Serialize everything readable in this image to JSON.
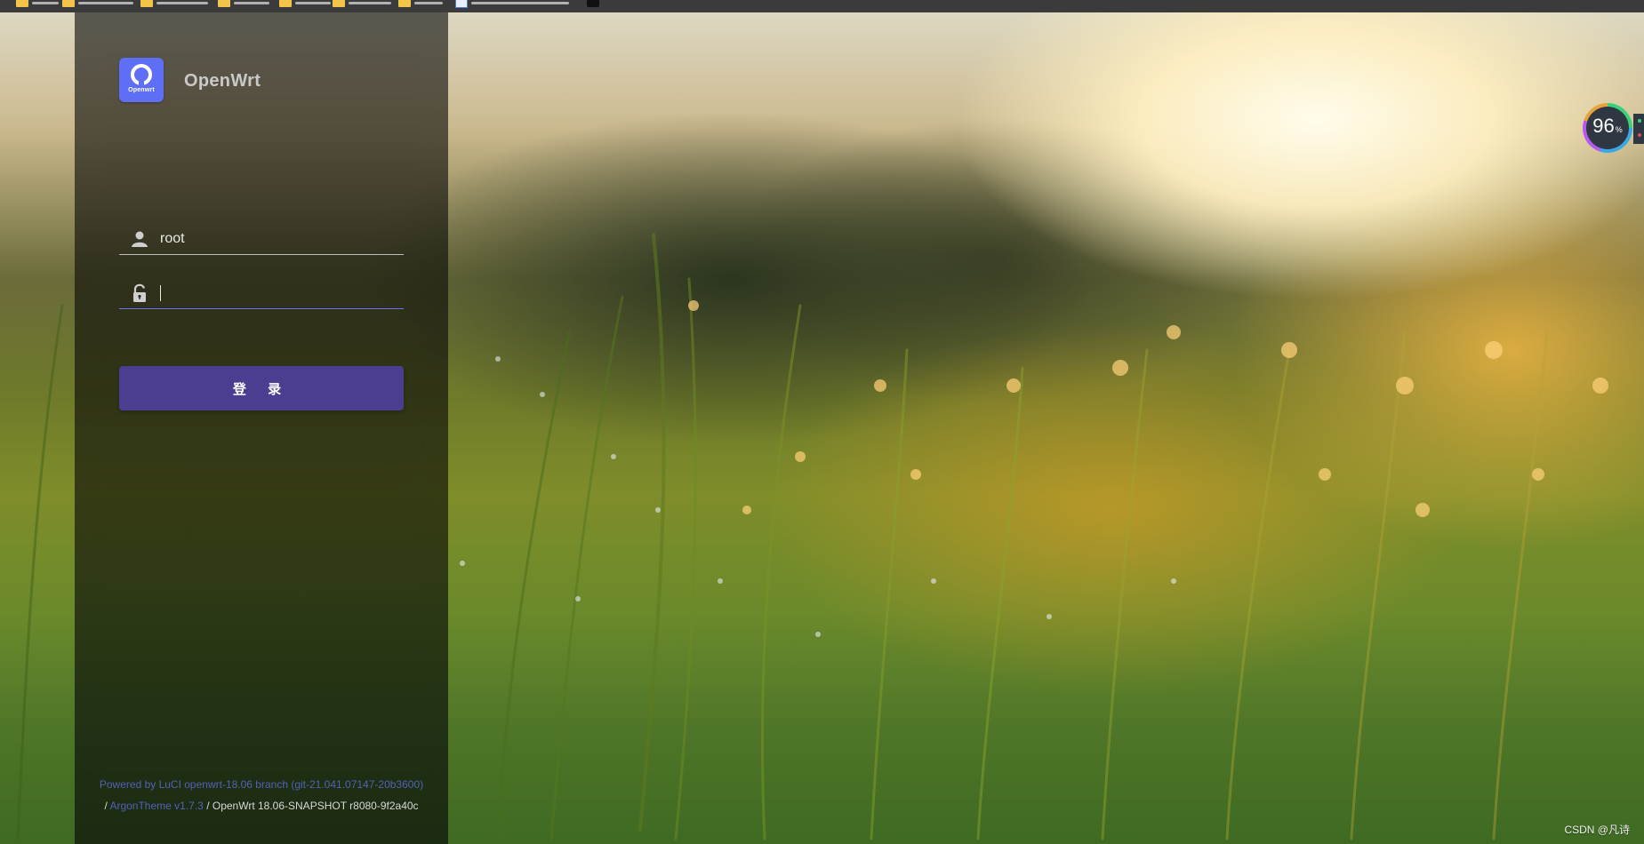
{
  "brand": {
    "logo_text": "Openwrt",
    "title": "OpenWrt",
    "color": "#5e6ff6"
  },
  "login": {
    "username_value": "root",
    "password_value": "",
    "button_label": "登 录",
    "button_color": "#4b3e91",
    "icons": {
      "user": "user-icon",
      "password": "unlock-icon"
    }
  },
  "footer": {
    "line1": "Powered by LuCI openwrt-18.06 branch (git-21.041.07147-20b3600)",
    "line2_sep1": "/ ",
    "theme_link": "ArgonTheme v1.7.3",
    "line2_rest": " / OpenWrt 18.06-SNAPSHOT r8080-9f2a40c",
    "link_color": "#5360b6"
  },
  "widget": {
    "value": "96",
    "unit": "%"
  },
  "watermark": "CSDN @凡诗"
}
